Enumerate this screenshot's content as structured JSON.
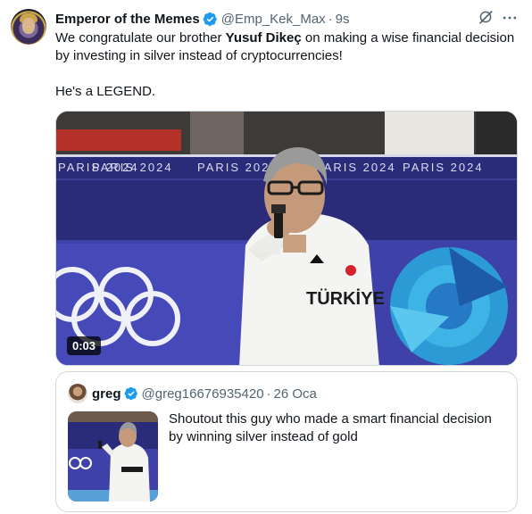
{
  "tweet": {
    "author": {
      "display_name": "Emperor of the Memes",
      "handle": "@Emp_Kek_Max",
      "verified": true
    },
    "separator": "·",
    "time": "9s",
    "text": {
      "line1_pre": "We congratulate our brother ",
      "line1_bold": "Yusuf Dikeç",
      "line1_post": " on making a wise financial decision by investing in silver instead of cryptocurrencies!",
      "line2": "He's a LEGEND."
    },
    "media": {
      "type": "video",
      "duration": "0:03",
      "banner_text": "PARIS 2024",
      "shirt_text": "TÜRKİYE"
    },
    "quote": {
      "author": {
        "display_name": "greg",
        "handle": "@greg16676935420",
        "verified": true
      },
      "separator": "·",
      "date": "26 Oca",
      "text": "Shoutout this guy who made a smart financial decision by winning silver instead of gold"
    }
  },
  "icons": {
    "verified": "verified-badge-icon",
    "grok": "grok-icon",
    "more": "more-dots-icon"
  },
  "colors": {
    "primary_text": "#0f1419",
    "secondary_text": "#536471",
    "verified_blue": "#1d9bf0",
    "border": "#cfd9de",
    "olympic_blue": "#2d2f66"
  }
}
